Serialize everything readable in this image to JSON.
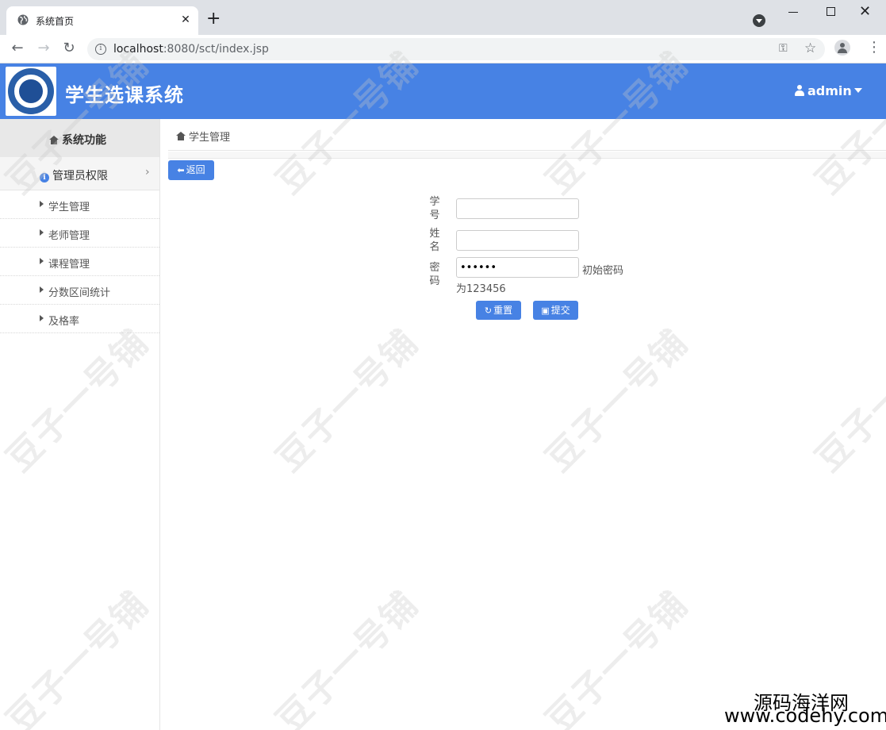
{
  "browser": {
    "tab_title": "系统首页",
    "tab_close": "✕",
    "new_tab": "+",
    "url_host": "localhost",
    "url_rest": ":8080/sct/index.jsp",
    "back": "←",
    "forward": "→",
    "reload": "↻",
    "win_close": "✕",
    "kebab": "⋮"
  },
  "header": {
    "app_title": "学生选课系统",
    "user_name": "admin"
  },
  "sidebar": {
    "heading": "系统功能",
    "group": "管理员权限",
    "items": [
      {
        "label": "学生管理"
      },
      {
        "label": "老师管理"
      },
      {
        "label": "课程管理"
      },
      {
        "label": "分数区间统计"
      },
      {
        "label": "及格率"
      }
    ]
  },
  "main": {
    "breadcrumb": "学生管理",
    "back_button": "返回",
    "form": {
      "student_id_label": "学号",
      "name_label": "姓名",
      "password_label": "密码",
      "student_id_value": "",
      "name_value": "",
      "password_value": "123456",
      "password_hint_1": "初始密码",
      "password_hint_2": "为123456",
      "reset_button": "重置",
      "submit_button": "提交"
    }
  },
  "watermark": {
    "text": "豆子一号铺",
    "site_name": "源码海洋网",
    "site_url": "www.codehy.com"
  },
  "colors": {
    "accent": "#4782e4",
    "chrome": "#dee1e6"
  }
}
